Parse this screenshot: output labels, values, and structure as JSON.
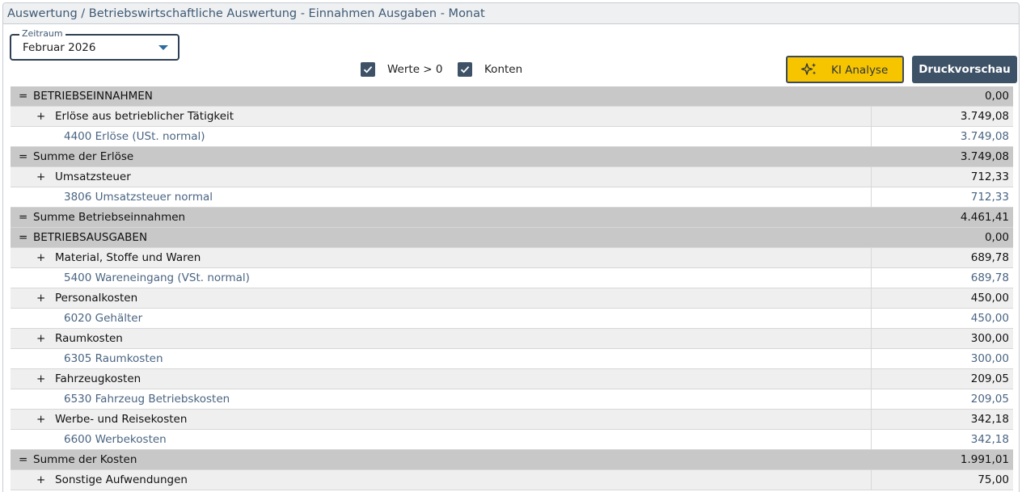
{
  "header": {
    "title": "Auswertung / Betriebswirtschaftliche Auswertung - Einnahmen Ausgaben - Monat"
  },
  "toolbar": {
    "zeitraum_label": "Zeitraum",
    "zeitraum_value": "Februar 2026",
    "checkbox_werte_label": "Werte > 0",
    "checkbox_werte_checked": true,
    "checkbox_konten_label": "Konten",
    "checkbox_konten_checked": true,
    "ki_button_label": "KI Analyse",
    "ki_button_icon": "sparkle-icon",
    "druck_button_label": "Druckvorschau"
  },
  "colors": {
    "accent_yellow": "#f7c400",
    "primary_dark": "#3d5167",
    "sum_row_bg": "#c8c8c8",
    "group_row_bg": "#efefef",
    "account_text": "#4a6582"
  },
  "table": {
    "rows": [
      {
        "type": "sum",
        "symbol": "=",
        "label": "BETRIEBSEINNAHMEN",
        "value": "0,00"
      },
      {
        "type": "group",
        "symbol": "+",
        "label": "Erlöse aus betrieblicher Tätigkeit",
        "value": "3.749,08"
      },
      {
        "type": "account",
        "symbol": "",
        "label": "4400 Erlöse (USt. normal)",
        "value": "3.749,08"
      },
      {
        "type": "sum",
        "symbol": "=",
        "label": " Summe der Erlöse",
        "value": "3.749,08"
      },
      {
        "type": "group",
        "symbol": "+",
        "label": "Umsatzsteuer",
        "value": "712,33"
      },
      {
        "type": "account",
        "symbol": "",
        "label": "3806 Umsatzsteuer normal",
        "value": "712,33"
      },
      {
        "type": "sum",
        "symbol": "=",
        "label": " Summe Betriebseinnahmen",
        "value": "4.461,41"
      },
      {
        "type": "sum",
        "symbol": "=",
        "label": "BETRIEBSAUSGABEN",
        "value": "0,00"
      },
      {
        "type": "group",
        "symbol": "+",
        "label": "Material, Stoffe und Waren",
        "value": "689,78"
      },
      {
        "type": "account",
        "symbol": "",
        "label": "5400 Wareneingang (VSt. normal)",
        "value": "689,78"
      },
      {
        "type": "group",
        "symbol": "+",
        "label": "Personalkosten",
        "value": "450,00"
      },
      {
        "type": "account",
        "symbol": "",
        "label": "6020 Gehälter",
        "value": "450,00"
      },
      {
        "type": "group",
        "symbol": "+",
        "label": "Raumkosten",
        "value": "300,00"
      },
      {
        "type": "account",
        "symbol": "",
        "label": "6305 Raumkosten",
        "value": "300,00"
      },
      {
        "type": "group",
        "symbol": "+",
        "label": "Fahrzeugkosten",
        "value": "209,05"
      },
      {
        "type": "account",
        "symbol": "",
        "label": "6530 Fahrzeug Betriebskosten",
        "value": "209,05"
      },
      {
        "type": "group",
        "symbol": "+",
        "label": "Werbe- und Reisekosten",
        "value": "342,18"
      },
      {
        "type": "account",
        "symbol": "",
        "label": "6600 Werbekosten",
        "value": "342,18"
      },
      {
        "type": "sum",
        "symbol": "=",
        "label": "Summe der Kosten",
        "value": "1.991,01"
      },
      {
        "type": "group",
        "symbol": "+",
        "label": "Sonstige Aufwendungen",
        "value": "75,00"
      }
    ]
  }
}
